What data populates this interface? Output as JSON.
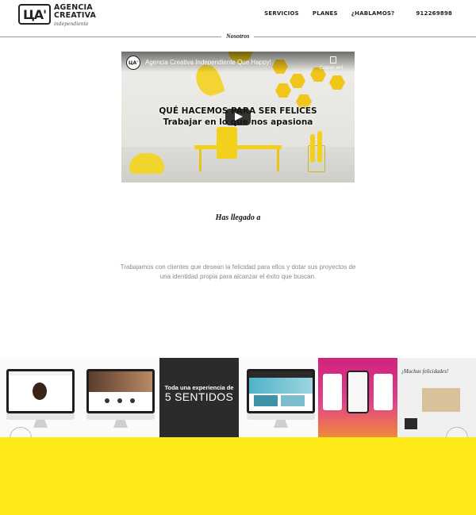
{
  "colors": {
    "accent_yellow": "#fce917",
    "text_dark": "#222222",
    "text_muted": "#8a8a8a"
  },
  "header": {
    "logo_mark": "ЦA'",
    "logo_line1": "AGENCIA",
    "logo_line2": "CREATIVA",
    "logo_tagline": "independiente",
    "nav": [
      "SERVICIOS",
      "PLANES",
      "¿HABLAMOS?"
    ],
    "phone": "912269898"
  },
  "section": {
    "label": "Nosotros"
  },
  "video": {
    "channel_icon": "ЦA'",
    "title": "Agencia Creativa Independiente Que Happy!",
    "copy_label": "Copiar enl...",
    "headline_line1": "QUÉ HACEMOS PARA SER FELICES",
    "headline_line2": "Trabajar en lo que nos apasiona"
  },
  "heading": "Has llegado a",
  "intro": "Trabajamos con clientes que desean la felicidad para ellos y dotar sus proyectos de una identidad propia para alcanzar el éxito que buscan.",
  "carousel": {
    "slide_dark_line1": "Toda una experiencia de",
    "slide_dark_line2": "5 SENTIDOS",
    "slide_gift_title": "¡Muchas felicidades!"
  }
}
